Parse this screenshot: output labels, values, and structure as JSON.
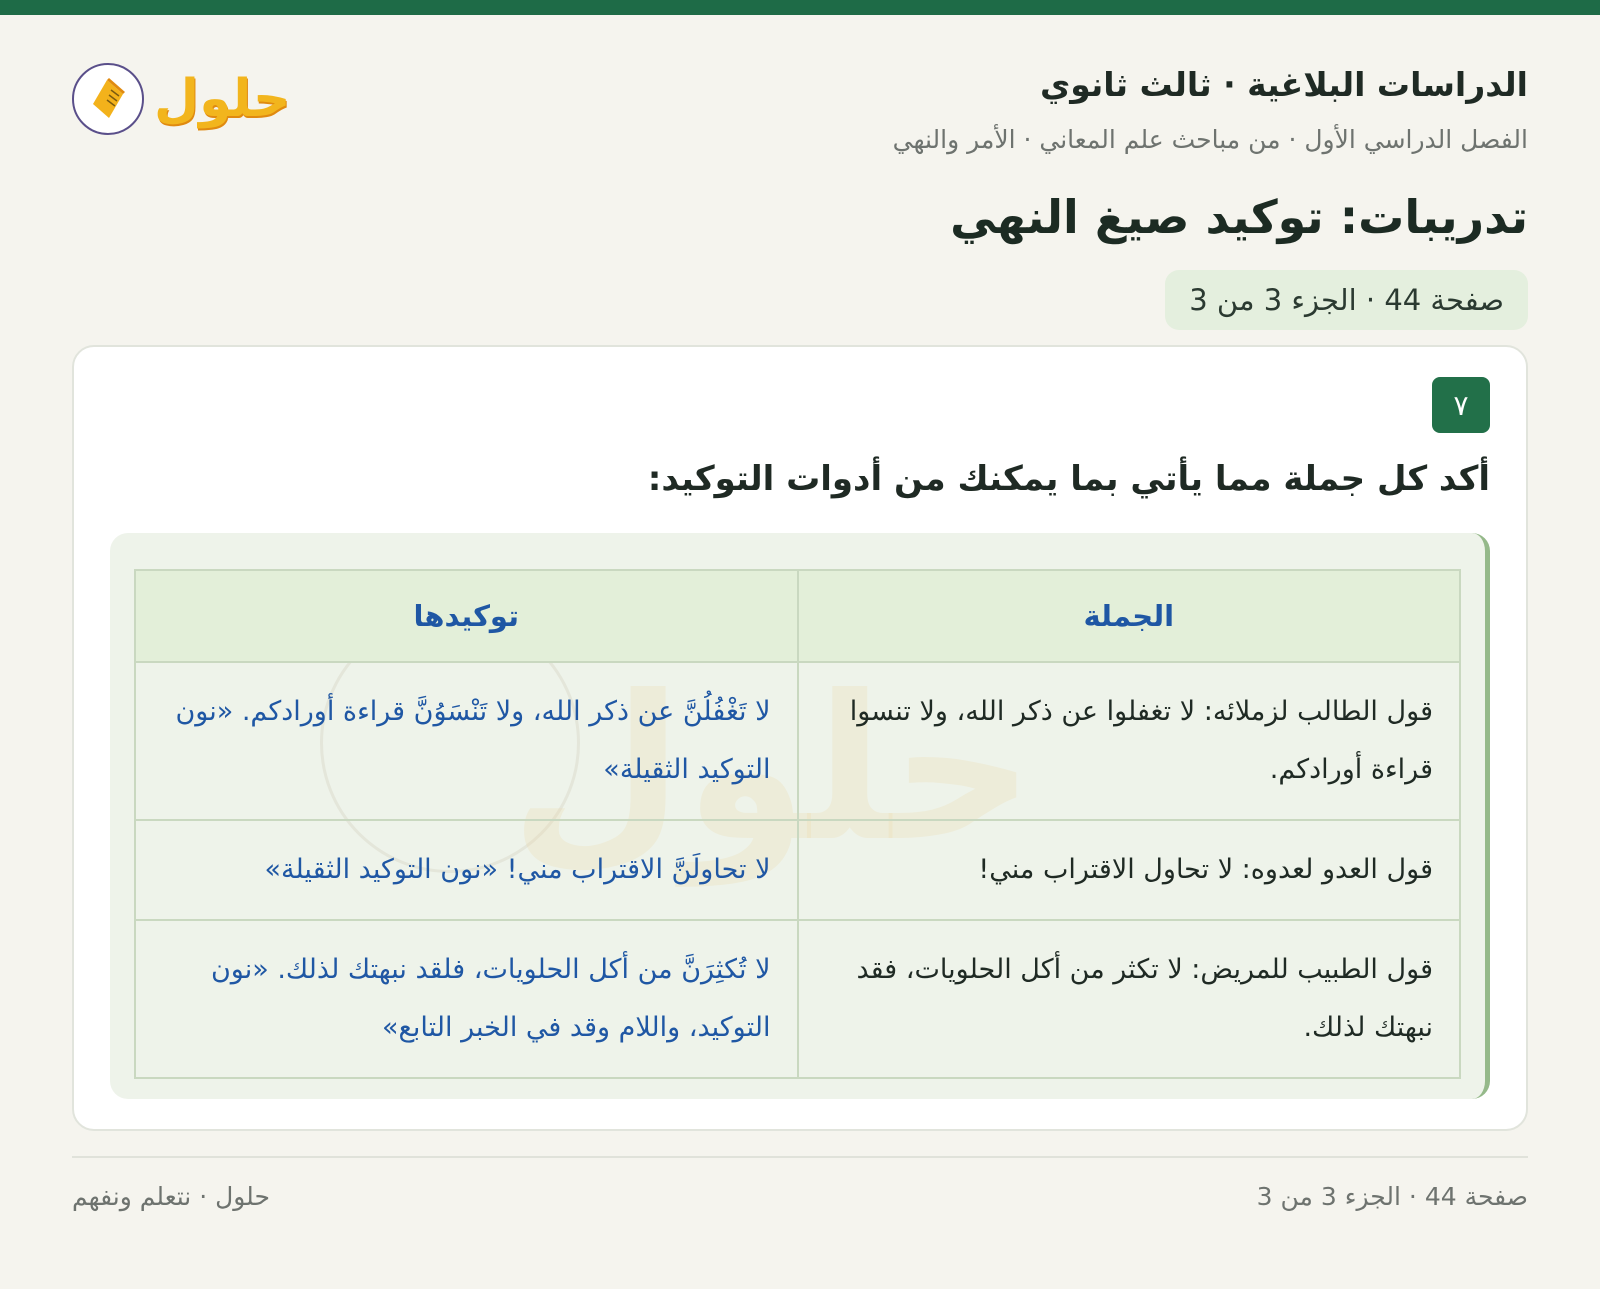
{
  "header": {
    "subject": "الدراسات البلاغية · ثالث ثانوي",
    "breadcrumb": "الفصل الدراسي الأول · من مباحث علم المعاني · الأمر والنهي",
    "title": "تدريبات: توكيد صيغ النهي",
    "page_badge": "صفحة 44 · الجزء 3 من 3",
    "logo_text": "حلول"
  },
  "exercise": {
    "number": "٧",
    "question": "أكد كل جملة مما يأتي بما يمكنك من أدوات التوكيد:",
    "table": {
      "headers": [
        "الجملة",
        "توكيدها"
      ],
      "rows": [
        {
          "sentence": "قول الطالب لزملائه: لا تغفلوا عن ذكر الله، ولا تنسوا قراءة أورادكم.",
          "answer": "لا تَغْفُلُنَّ عن ذكر الله، ولا تَنْسَوُنَّ قراءة أورادكم. «نون التوكيد الثقيلة»"
        },
        {
          "sentence": "قول العدو لعدوه: لا تحاول الاقتراب مني!",
          "answer": "لا تحاولَنَّ الاقتراب مني! «نون التوكيد الثقيلة»"
        },
        {
          "sentence": "قول الطبيب للمريض: لا تكثر من أكل الحلويات، فقد نبهتك لذلك.",
          "answer": "لا تُكثِرَنَّ من أكل الحلويات، فلقد نبهتك لذلك. «نون التوكيد، واللام وقد في الخبر التابع»"
        }
      ]
    }
  },
  "footer": {
    "page_info": "صفحة 44 · الجزء 3 من 3",
    "brand": "حلول · نتعلم ونفهم"
  },
  "colors": {
    "accent": "#1e6b47",
    "answer_text": "#1f57a4",
    "panel_bg": "#eef3ea",
    "header_cell_bg": "#e3efd9"
  }
}
